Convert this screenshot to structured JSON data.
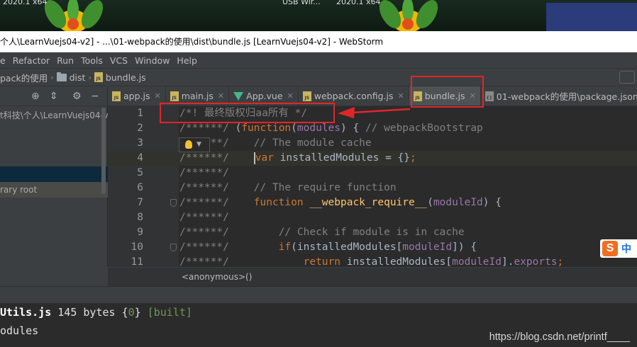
{
  "desktop": {
    "label_left": "2020.1 x64",
    "label_mid1": "USB Wir...",
    "label_mid2": "2020.1 x64"
  },
  "window": {
    "title": "个人\\LearnVuejs04-v2] - ...\\01-webpack的使用\\dist\\bundle.js [LearnVuejs04-v2] - WebStorm"
  },
  "menu": {
    "items": [
      {
        "label": "e"
      },
      {
        "label": "Refactor"
      },
      {
        "label": "Run"
      },
      {
        "label": "Tools"
      },
      {
        "label": "VCS"
      },
      {
        "label": "Window"
      },
      {
        "label": "Help"
      }
    ]
  },
  "breadcrumb": {
    "items": [
      {
        "label": "pack的使用"
      },
      {
        "label": "dist"
      },
      {
        "label": "bundle.js"
      }
    ]
  },
  "project": {
    "path": "t科技\\个人\\LearnVuejs04-v",
    "library_root": "rary root"
  },
  "tabs": [
    {
      "label": "app.js",
      "icon": "js-icon"
    },
    {
      "label": "main.js",
      "icon": "js-icon"
    },
    {
      "label": "App.vue",
      "icon": "vue-icon"
    },
    {
      "label": "webpack.config.js",
      "icon": "js-icon"
    },
    {
      "label": "bundle.js",
      "icon": "js-icon",
      "active": true
    },
    {
      "label": "01-webpack的使用\\package.json",
      "icon": "json-icon"
    }
  ],
  "editor": {
    "lines": [
      {
        "n": "1",
        "parts": [
          [
            "c-gray",
            "/*! 最终版权归aa所有 */"
          ]
        ]
      },
      {
        "n": "2",
        "parts": [
          [
            "c-gray",
            "/******/ "
          ],
          [
            "c-id",
            "("
          ],
          [
            "c-kw",
            "function"
          ],
          [
            "c-id",
            "("
          ],
          [
            "c-param",
            "modules"
          ],
          [
            "c-id",
            ") { "
          ],
          [
            "c-gray",
            "// webpackBootstrap"
          ]
        ]
      },
      {
        "n": "3",
        "parts": [
          [
            "c-gray",
            "/******/    "
          ],
          [
            "c-gray",
            "// The module cache"
          ]
        ]
      },
      {
        "n": "4",
        "parts": [
          [
            "c-gray",
            "/******/    "
          ],
          [
            "c-kw",
            "var "
          ],
          [
            "c-id",
            "installedModules = {}"
          ],
          [
            "c-kw",
            ";"
          ]
        ],
        "current": true
      },
      {
        "n": "5",
        "parts": [
          [
            "c-gray",
            "/******/"
          ]
        ]
      },
      {
        "n": "6",
        "parts": [
          [
            "c-gray",
            "/******/    "
          ],
          [
            "c-gray",
            "// The require function"
          ]
        ]
      },
      {
        "n": "7",
        "parts": [
          [
            "c-gray",
            "/******/    "
          ],
          [
            "c-kw",
            "function "
          ],
          [
            "c-fn",
            "__webpack_require__"
          ],
          [
            "c-id",
            "("
          ],
          [
            "c-param",
            "moduleId"
          ],
          [
            "c-id",
            ") {"
          ]
        ],
        "fold": true
      },
      {
        "n": "8",
        "parts": [
          [
            "c-gray",
            "/******/"
          ]
        ]
      },
      {
        "n": "9",
        "parts": [
          [
            "c-gray",
            "/******/        "
          ],
          [
            "c-gray",
            "// Check if module is in cache"
          ]
        ]
      },
      {
        "n": "10",
        "parts": [
          [
            "c-gray",
            "/******/        "
          ],
          [
            "c-kw",
            "if"
          ],
          [
            "c-id",
            "(installedModules["
          ],
          [
            "c-param",
            "moduleId"
          ],
          [
            "c-id",
            "]) {"
          ]
        ],
        "fold": true
      },
      {
        "n": "11",
        "parts": [
          [
            "c-gray",
            "/******/            "
          ],
          [
            "c-kw",
            "return "
          ],
          [
            "c-id",
            "installedModules["
          ],
          [
            "c-param",
            "moduleId"
          ],
          [
            "c-id",
            "]."
          ],
          [
            "c-field",
            "exports"
          ],
          [
            "c-kw",
            ";"
          ]
        ]
      }
    ],
    "status": "<anonymous>()"
  },
  "console": {
    "line1_file": "Utils.js",
    "line1_size": "145 bytes",
    "line1_brace_open": "{",
    "line1_num": "0",
    "line1_brace_close": "}",
    "line1_built": "[built]",
    "line2": "odules"
  },
  "watermark": "https://blog.csdn.net/printf____",
  "ime": {
    "s": "S",
    "zh": "中"
  },
  "colors": {
    "annotation": "#e0262b",
    "background": "#2b2b2b",
    "keyword": "#cc7832",
    "comment": "#808080"
  }
}
